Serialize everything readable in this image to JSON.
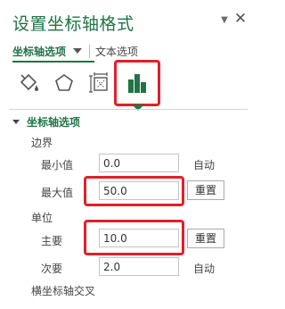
{
  "pane": {
    "title": "设置坐标轴格式",
    "pin_icon": "pin-down-triangle-icon",
    "close_glyph": "✕"
  },
  "tabs": {
    "axis_options": "坐标轴选项",
    "text_options": "文本选项"
  },
  "icon_tabs": [
    {
      "name": "fill-line-icon",
      "selected": false
    },
    {
      "name": "effects-pentagon-icon",
      "selected": false
    },
    {
      "name": "size-properties-icon",
      "selected": false
    },
    {
      "name": "axis-options-bar-chart-icon",
      "selected": true
    }
  ],
  "section": {
    "title": "坐标轴选项"
  },
  "bounds": {
    "label": "边界",
    "min_label": "最小值",
    "min_value": "0.0",
    "min_state": "自动",
    "max_label": "最大值",
    "max_value": "50.0",
    "max_reset": "重置"
  },
  "units": {
    "label": "单位",
    "major_label": "主要",
    "major_value": "10.0",
    "major_reset": "重置",
    "minor_label": "次要",
    "minor_value": "2.0",
    "minor_state": "自动"
  },
  "cross": {
    "label": "横坐标轴交叉"
  },
  "colors": {
    "accent": "#217346",
    "highlight": "#e0202a"
  }
}
